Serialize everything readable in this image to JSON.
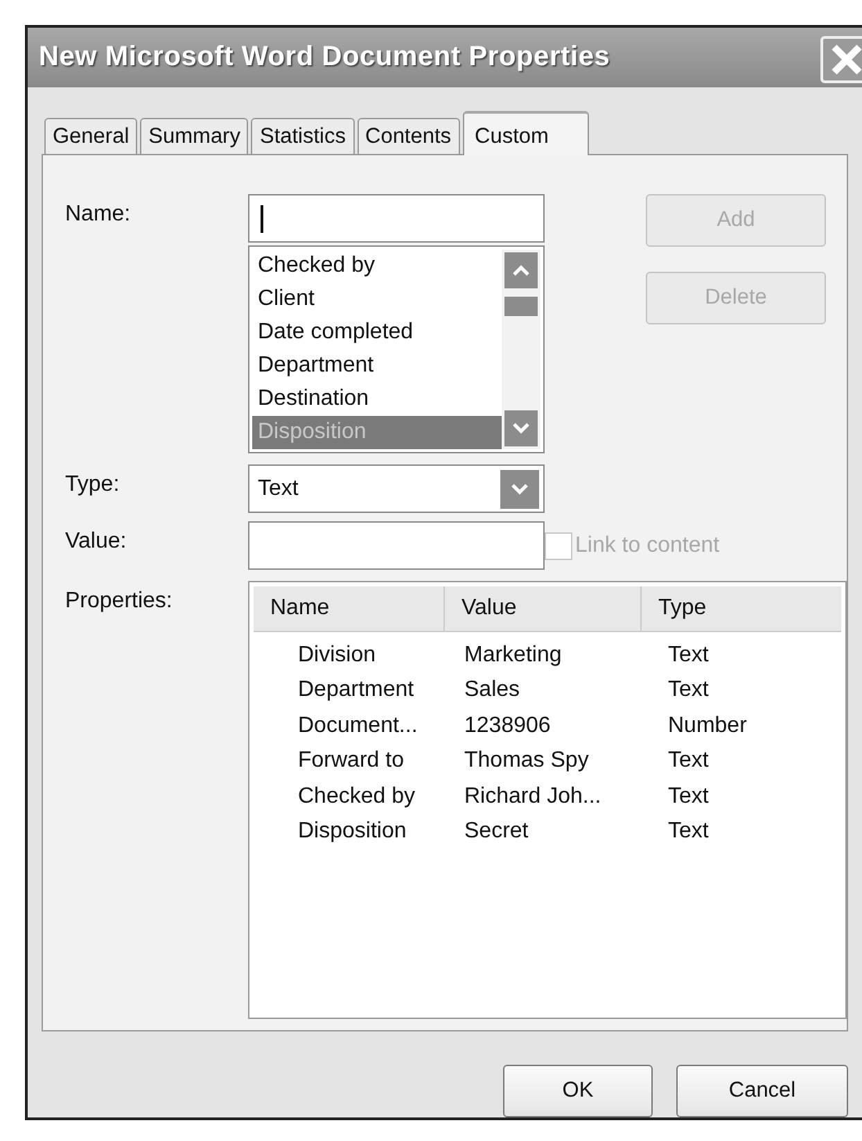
{
  "window": {
    "title": "New Microsoft Word Document Properties"
  },
  "tabs": [
    {
      "label": "General",
      "selected": false
    },
    {
      "label": "Summary",
      "selected": false
    },
    {
      "label": "Statistics",
      "selected": false
    },
    {
      "label": "Contents",
      "selected": false
    },
    {
      "label": "Custom",
      "selected": true
    }
  ],
  "name_field": {
    "label": "Name:"
  },
  "name_list": [
    {
      "label": "Checked by",
      "selected": false
    },
    {
      "label": "Client",
      "selected": false
    },
    {
      "label": "Date completed",
      "selected": false
    },
    {
      "label": "Department",
      "selected": false
    },
    {
      "label": "Destination",
      "selected": false
    },
    {
      "label": "Disposition",
      "selected": true
    }
  ],
  "side_buttons": [
    {
      "label": "Add",
      "disabled": true
    },
    {
      "label": "Delete",
      "disabled": true
    }
  ],
  "type_field": {
    "label": "Type:",
    "value": "Text"
  },
  "value_field": {
    "label": "Value:"
  },
  "link_checkbox": {
    "label": "Link to content",
    "checked": false,
    "disabled": true
  },
  "properties": {
    "label": "Properties:",
    "columns": [
      "Name",
      "Value",
      "Type"
    ],
    "rows": [
      [
        "Division",
        "Marketing",
        "Text"
      ],
      [
        "Department",
        "Sales",
        "Text"
      ],
      [
        "Document...",
        "1238906",
        "Number"
      ],
      [
        "Forward to",
        "Thomas Spy",
        "Text"
      ],
      [
        "Checked by",
        "Richard Joh...",
        "Text"
      ],
      [
        "Disposition",
        "Secret",
        "Text"
      ]
    ]
  },
  "buttons": [
    {
      "label": "OK",
      "disabled": false
    },
    {
      "label": "Cancel",
      "disabled": false
    }
  ]
}
